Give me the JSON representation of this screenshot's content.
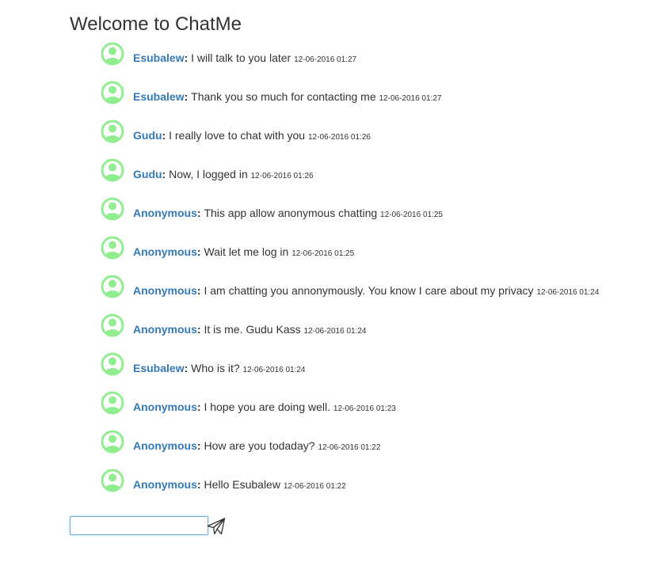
{
  "page": {
    "title": "Welcome to ChatMe"
  },
  "colors": {
    "author": "#337ab7",
    "avatar": "#90ee90",
    "text": "#333333",
    "input_border": "#66afe9"
  },
  "messages": [
    {
      "author": "Esubalew",
      "text": "I will talk to you later",
      "time": "12-06-2016 01:27",
      "avatar_icon": "user-avatar-icon"
    },
    {
      "author": "Esubalew",
      "text": "Thank you so much for contacting me",
      "time": "12-06-2016 01:27",
      "avatar_icon": "user-avatar-icon"
    },
    {
      "author": "Gudu",
      "text": "I really love to chat with you",
      "time": "12-06-2016 01:26",
      "avatar_icon": "user-avatar-icon"
    },
    {
      "author": "Gudu",
      "text": "Now, I logged in",
      "time": "12-06-2016 01:26",
      "avatar_icon": "user-avatar-icon"
    },
    {
      "author": "Anonymous",
      "text": "This app allow anonymous chatting",
      "time": "12-06-2016 01:25",
      "avatar_icon": "user-avatar-icon"
    },
    {
      "author": "Anonymous",
      "text": "Wait let me log in",
      "time": "12-06-2016 01:25",
      "avatar_icon": "user-avatar-icon"
    },
    {
      "author": "Anonymous",
      "text": "I am chatting you annonymously. You know I care about my privacy",
      "time": "12-06-2016 01:24",
      "avatar_icon": "user-avatar-icon"
    },
    {
      "author": "Anonymous",
      "text": "It is me. Gudu Kass",
      "time": "12-06-2016 01:24",
      "avatar_icon": "user-avatar-icon"
    },
    {
      "author": "Esubalew",
      "text": "Who is it?",
      "time": "12-06-2016 01:24",
      "avatar_icon": "user-avatar-icon"
    },
    {
      "author": "Anonymous",
      "text": "I hope you are doing well.",
      "time": "12-06-2016 01:23",
      "avatar_icon": "user-avatar-icon"
    },
    {
      "author": "Anonymous",
      "text": "How are you todaday?",
      "time": "12-06-2016 01:22",
      "avatar_icon": "user-avatar-icon"
    },
    {
      "author": "Anonymous",
      "text": "Hello Esubalew",
      "time": "12-06-2016 01:22",
      "avatar_icon": "user-avatar-icon"
    }
  ],
  "composer": {
    "input_value": "",
    "send_icon": "paper-plane-icon"
  }
}
